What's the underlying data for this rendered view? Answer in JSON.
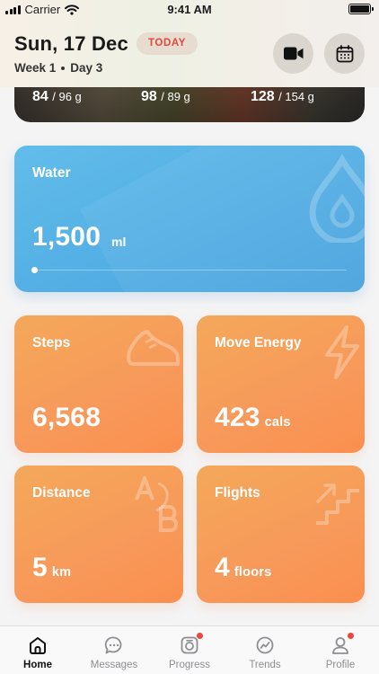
{
  "status_bar": {
    "carrier": "Carrier",
    "time": "9:41 AM"
  },
  "header": {
    "date": "Sun, 17 Dec",
    "today_badge": "TODAY",
    "week": "Week 1",
    "day": "Day 3",
    "icons": [
      "video-icon",
      "calendar-icon"
    ]
  },
  "meal_summary": {
    "macros": [
      {
        "value": "84",
        "target": "/ 96 g"
      },
      {
        "value": "98",
        "target": "/ 89 g"
      },
      {
        "value": "128",
        "target": "/ 154 g"
      }
    ]
  },
  "water": {
    "title": "Water",
    "value": "1,500",
    "unit": "ml",
    "progress": 0,
    "colors": {
      "from": "#62bdea",
      "to": "#48a2de"
    }
  },
  "stats": {
    "steps": {
      "title": "Steps",
      "value": "6,568",
      "unit": ""
    },
    "move_energy": {
      "title": "Move Energy",
      "value": "423",
      "unit": "cals"
    },
    "distance": {
      "title": "Distance",
      "value": "5",
      "unit": "km"
    },
    "flights": {
      "title": "Flights",
      "value": "4",
      "unit": "floors"
    },
    "accent": "#f7995a"
  },
  "tabbar": {
    "tabs": [
      {
        "label": "Home",
        "icon": "home-icon",
        "active": true,
        "badge": false
      },
      {
        "label": "Messages",
        "icon": "chat-icon",
        "active": false,
        "badge": false
      },
      {
        "label": "Progress",
        "icon": "camera-icon",
        "active": false,
        "badge": true
      },
      {
        "label": "Trends",
        "icon": "trends-icon",
        "active": false,
        "badge": false
      },
      {
        "label": "Profile",
        "icon": "person-icon",
        "active": false,
        "badge": true
      }
    ]
  }
}
